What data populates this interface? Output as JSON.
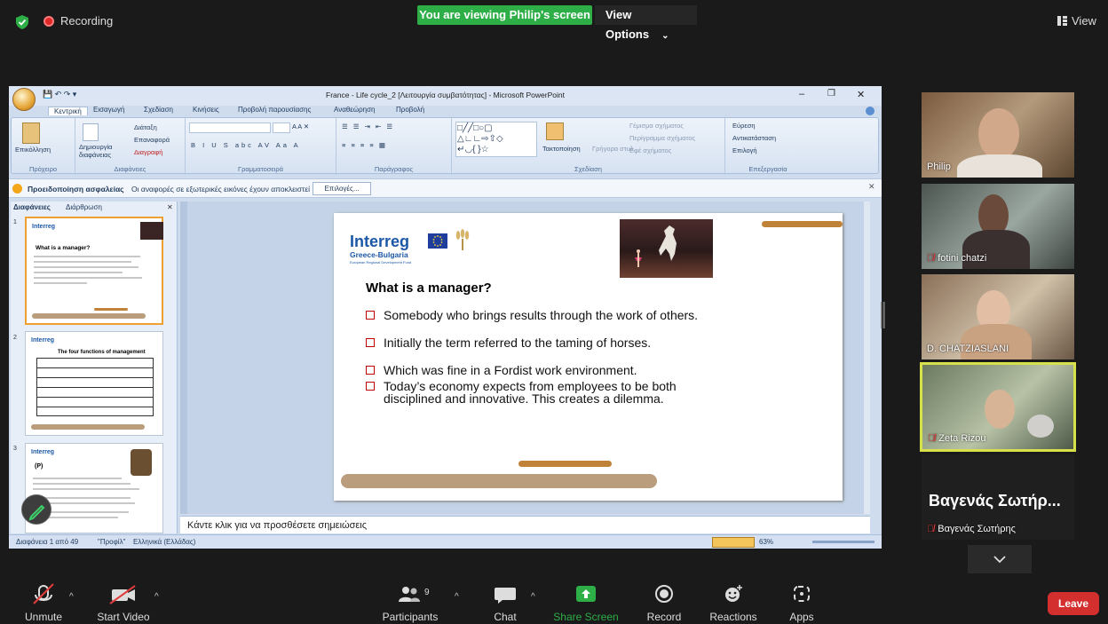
{
  "top_bar": {
    "recording_label": "Recording",
    "viewing_banner": "You are viewing Philip's screen",
    "view_options_label": "View Options",
    "view_label": "View"
  },
  "powerpoint": {
    "window_title": "France - Life cycle_2 [Λειτουργία συμβατότητας] - Microsoft PowerPoint",
    "tabs": [
      "Κεντρική",
      "Εισαγωγή",
      "Σχεδίαση",
      "Κινήσεις",
      "Προβολή παρουσίασης",
      "Αναθεώρηση",
      "Προβολή"
    ],
    "ribbon": {
      "paste": "Επικόλληση",
      "layout": "Διάταξη",
      "reset": "Επαναφορά",
      "new_slide": "Δημιουργία διαφάνειας",
      "delete": "Διαγραφή",
      "arrange": "Τακτοποίηση",
      "quick_styles": "Γρήγορα στυλ",
      "shape_fill": "Γέμισμα σχήματος",
      "shape_outline": "Περίγραμμα σχήματος",
      "shape_effects": "Εφέ σχήματος",
      "find": "Εύρεση",
      "replace": "Αντικατάσταση",
      "select": "Επιλογή",
      "groups": [
        "Πρόχειρο",
        "Διαφάνειες",
        "Γραμματοσειρά",
        "Παράγραφος",
        "Σχεδίαση",
        "Επεξεργασία"
      ]
    },
    "security_warning": {
      "title": "Προειδοποίηση ασφαλείας",
      "message": "Οι αναφορές σε εξωτερικές εικόνες έχουν αποκλειστεί",
      "options_button": "Επιλογές..."
    },
    "panel_tabs": [
      "Διαφάνειες",
      "Διάρθρωση"
    ],
    "thumbnails": [
      {
        "num": "1",
        "title": "What is a manager?"
      },
      {
        "num": "2",
        "title": "The four functions of management"
      },
      {
        "num": "3",
        "title": "(P)"
      }
    ],
    "slide": {
      "logo": "Interreg",
      "logo_sub": "Greece-Bulgaria",
      "logo_fund": "European Regional Development Fund",
      "title": "What is a manager?",
      "bullets": [
        "Somebody who brings results through the work of others.",
        "Initially the term referred to the taming of horses.",
        "Which was fine in a Fordist work environment.",
        "Today’s economy expects from employees to be both disciplined and innovative. This creates a dilemma."
      ]
    },
    "notes_placeholder": "Κάντε κλικ για να προσθέσετε σημειώσεις",
    "status": {
      "slide_count": "Διαφάνεια 1 από 49",
      "theme": "\"Προφίλ\"",
      "language": "Ελληνικά (Ελλάδας)",
      "zoom": "63%"
    }
  },
  "participants": [
    {
      "name": "Philip",
      "muted": false
    },
    {
      "name": "fotini chatzi",
      "muted": true
    },
    {
      "name": "D. CHATZIASLANI",
      "muted": false
    },
    {
      "name": "Zeta Rizou",
      "muted": true
    },
    {
      "name": "Βαγενάς Σωτήρης",
      "muted": true,
      "display_big": "Βαγενάς Σωτήρ..."
    }
  ],
  "toolbar": {
    "unmute": "Unmute",
    "start_video": "Start Video",
    "participants": "Participants",
    "participant_count": "9",
    "chat": "Chat",
    "share_screen": "Share Screen",
    "record": "Record",
    "reactions": "Reactions",
    "apps": "Apps",
    "leave": "Leave"
  },
  "colors": {
    "share_green": "#2dae47",
    "leave_red": "#d32f2f",
    "active_speaker": "#d7e24a",
    "bullet_red": "#c00000"
  }
}
